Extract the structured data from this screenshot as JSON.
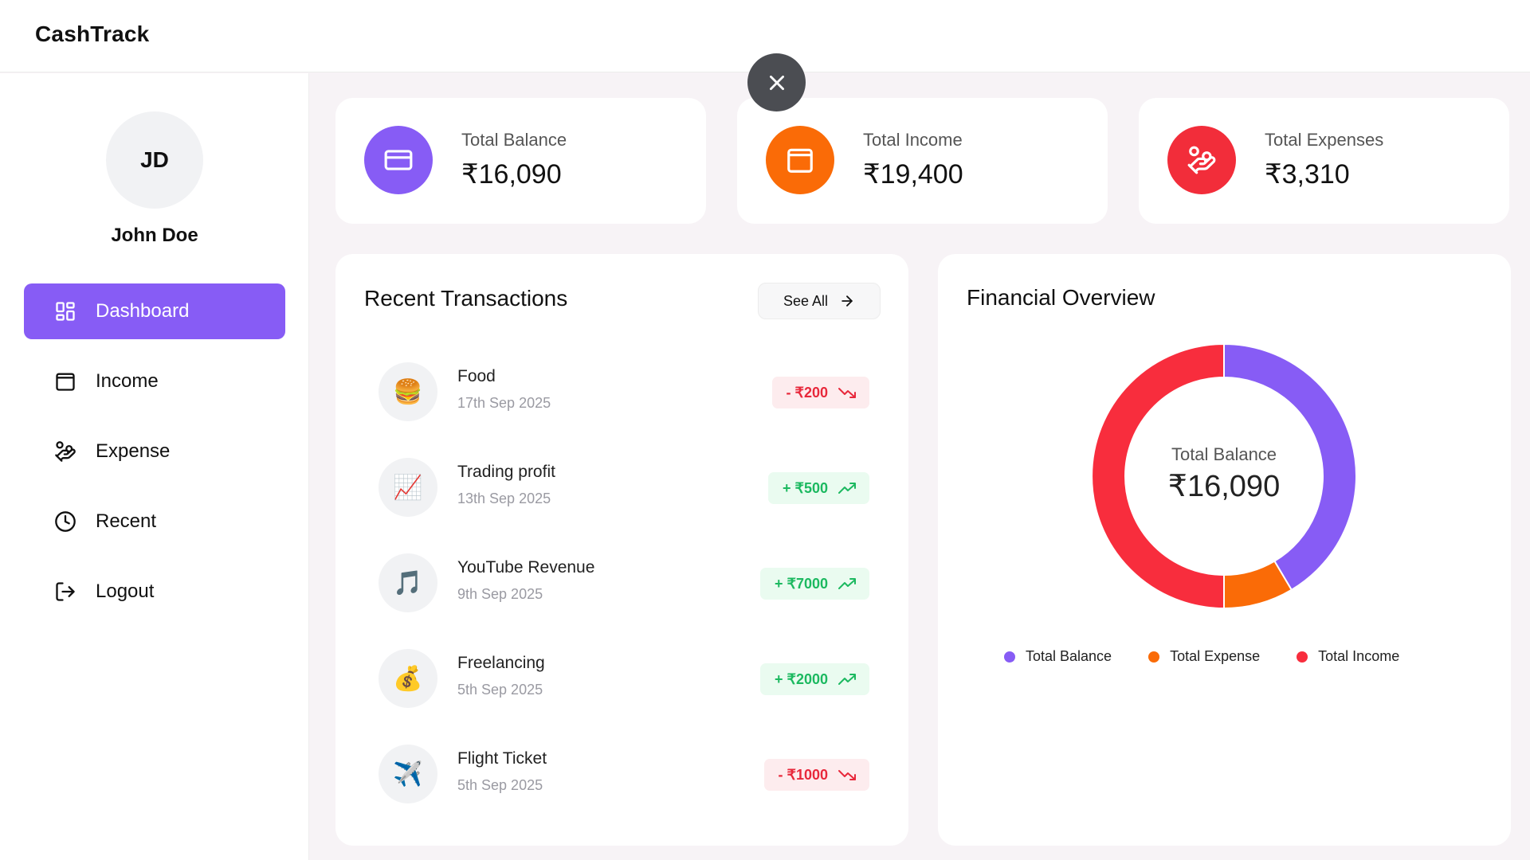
{
  "app": {
    "name": "CashTrack"
  },
  "user": {
    "initials": "JD",
    "name": "John Doe"
  },
  "nav": [
    {
      "label": "Dashboard",
      "icon": "dashboard-icon",
      "active": true
    },
    {
      "label": "Income",
      "icon": "wallet-icon",
      "active": false
    },
    {
      "label": "Expense",
      "icon": "hand-coins-icon",
      "active": false
    },
    {
      "label": "Recent",
      "icon": "clock-icon",
      "active": false
    },
    {
      "label": "Logout",
      "icon": "logout-icon",
      "active": false
    }
  ],
  "stats": [
    {
      "label": "Total Balance",
      "value": "₹16,090",
      "color": "#875cf5",
      "icon": "credit-card-icon"
    },
    {
      "label": "Total Income",
      "value": "₹19,400",
      "color": "#fa6b07",
      "icon": "wallet-icon"
    },
    {
      "label": "Total Expenses",
      "value": "₹3,310",
      "color": "#f22d3a",
      "icon": "hand-coins-icon"
    }
  ],
  "recent": {
    "title": "Recent Transactions",
    "see_all_label": "See All",
    "items": [
      {
        "name": "Food",
        "date": "17th Sep 2025",
        "amount": "- ₹200",
        "type": "expense",
        "icon": "🍔"
      },
      {
        "name": "Trading profit",
        "date": "13th Sep 2025",
        "amount": "+ ₹500",
        "type": "income",
        "icon": "📈"
      },
      {
        "name": "YouTube Revenue",
        "date": "9th Sep 2025",
        "amount": "+ ₹7000",
        "type": "income",
        "icon": "🎵"
      },
      {
        "name": "Freelancing",
        "date": "5th Sep 2025",
        "amount": "+ ₹2000",
        "type": "income",
        "icon": "💰"
      },
      {
        "name": "Flight Ticket",
        "date": "5th Sep 2025",
        "amount": "- ₹1000",
        "type": "expense",
        "icon": "✈️"
      }
    ]
  },
  "overview": {
    "title": "Financial Overview",
    "center_label": "Total Balance",
    "center_value": "₹16,090"
  },
  "chart_data": {
    "type": "pie",
    "categories": [
      "Total Balance",
      "Total Expense",
      "Total Income"
    ],
    "values": [
      16090,
      3310,
      19400
    ],
    "colors": [
      "#875cf5",
      "#fa6b07",
      "#f82d3d"
    ],
    "legend": "bottom"
  }
}
